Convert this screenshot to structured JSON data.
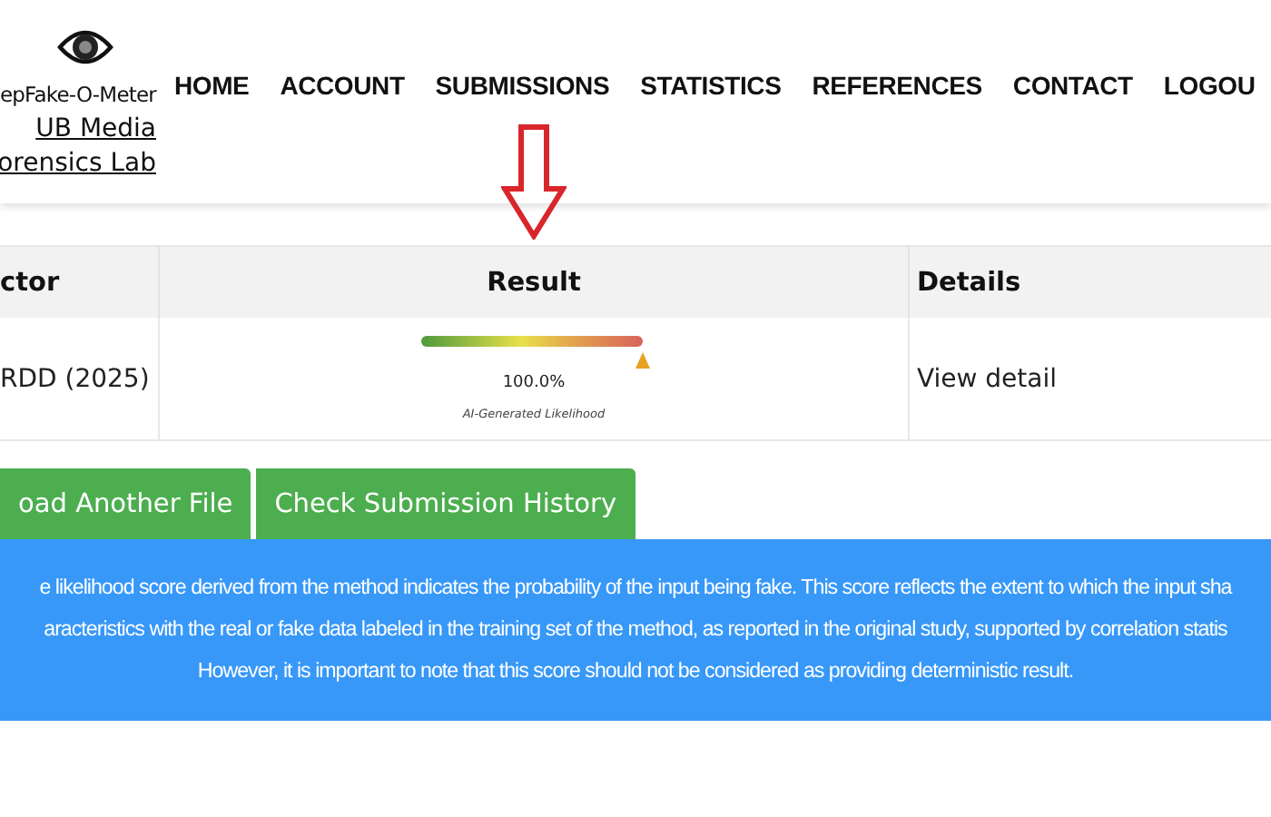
{
  "brand": {
    "name": "epFake-O-Meter",
    "lab_lines": [
      "UB Media",
      "orensics Lab"
    ]
  },
  "nav": [
    {
      "label": "HOME"
    },
    {
      "label": "ACCOUNT"
    },
    {
      "label": "SUBMISSIONS"
    },
    {
      "label": "STATISTICS"
    },
    {
      "label": "REFERENCES"
    },
    {
      "label": "CONTACT"
    },
    {
      "label": "LOGOU"
    }
  ],
  "table": {
    "columns": [
      "ctor",
      "Result",
      "Details"
    ],
    "rows": [
      {
        "detector": "RDD (2025)",
        "result": {
          "reading": "100.0%",
          "caption": "AI-Generated Likelihood"
        },
        "details": "View detail"
      }
    ]
  },
  "buttons": [
    "oad Another File",
    "Check Submission History"
  ],
  "notice": {
    "lines": [
      "e likelihood score derived from the method indicates the probability of the input being fake. This score reflects the extent to which the input sha",
      "aracteristics with the real or fake data labeled in the training set of the method, as reported in the original study, supported by correlation statis",
      "However, it is important to note that this score should not be considered as providing deterministic result."
    ]
  }
}
